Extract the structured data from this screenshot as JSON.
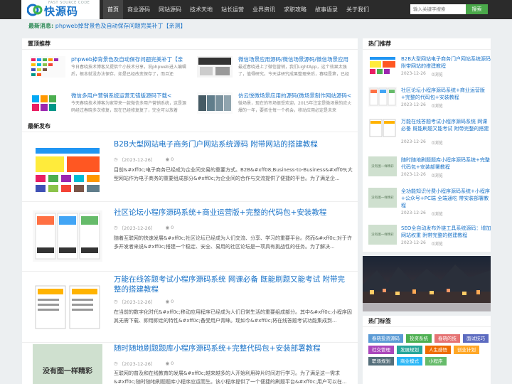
{
  "header": {
    "logo_text": "快源码",
    "logo_sub": "FAST SOURCE CODE",
    "nav": [
      "首页",
      "商业源码",
      "网站源码",
      "技术天地",
      "站长运营",
      "业界资讯",
      "求职攻略",
      "故事语录",
      "关于我们"
    ],
    "search_placeholder": "输入关键字搜索",
    "search_button": "搜索"
  },
  "ticker": {
    "label": "最新消息:",
    "text": "phpweb掉背景色及自动保存问题完美补丁【亲测】"
  },
  "featured": {
    "title": "置顶推荐",
    "items": [
      {
        "title": "phpweb掉背景色及自动保存问题完美补丁【亲",
        "desc": "今日春晓技术博客又提供个小技术分享，说phpweb进入编辑后，根本就没办法保存，如是已经改变保存了，而且还"
      },
      {
        "title": "微信多用户营销系统运营无错版源码下载<",
        "desc": "今天春晓技术博客为家带来一款微信多用户营销系统，这是源码经过春晓多次修复，现在已经修复复了，完全可以放着"
      },
      {
        "title": "微信场景应用源码/微信场景源码/微信场景应用",
        "desc": "最近春晓进上了微信营销，我们LightApp，这个效果太强了，值得研究。今天讲研究成果整理来后，春晓是第，已经"
      },
      {
        "title": "仿云悦微场景应用的源码(微场景制作网站源码<",
        "desc": "微场景，现在的市场很受欢迎，2015年注定是微场景的应火爆的一年，要抓住每一个机会，移动应用必定是未来"
      }
    ]
  },
  "latest": {
    "title": "最新发布",
    "items": [
      {
        "title": "B2B大型网站电子商务门户网站系统源码 附带网站的搭建教程",
        "date": "〔2023-12-26〕",
        "comments": "0",
        "desc": "目前&#xff0c;电子商务已经成为企业间交易的重要方式。B2B&#xff08;Business-to-Business&#xff09;大型网站作为电子商务的重要组成部分&#xff0c;为企业间的合作与交流提供了便捷的平台。为了满足企..."
      },
      {
        "title": "社区论坛小程序源码系统+商业运营版+完整的代码包+安装教程",
        "date": "〔2023-12-26〕",
        "comments": "0",
        "desc": "随着互联网的快速发展&#xff0c;社区论坛已经成为人们交流、分享、学习的重要平台。然而&#xff0c;对于许多开发者来说&#xff0c;搭建一个稳定、安全、易用的社区论坛是一项具有挑战性的任务。为了解决..."
      },
      {
        "title": "万能在线答题考试小程序源码系统 网课必备 既能刷题又能考试 附带完整的搭建教程",
        "date": "〔2023-12-26〕",
        "comments": "0",
        "desc": "在当前的数字化时代&#xff0c;移动应用程序已经成为人们日常生活的重要组成部分。其中&#xff0c;小程序因其无需下载、即用即走的特性&#xff0c;备受用户青睐。现如今&#xff0c;将在线答题考试功能集成到..."
      },
      {
        "title": "随时随地刷题题库小程序源码系统+完整代码包+安装部署教程",
        "date": "〔2023-12-26〕",
        "comments": "0",
        "desc": "互联网的普及和在线教育的发展&#xff0c;越来越多的人开始利用碎片时间进行学习。为了满足这一需求&#xff0c;随时随地刷题题库小程序应运而生。该小程序提供了一个便捷的刷题平台&#xff0c;用户可以在..."
      }
    ],
    "thumb4_text": "没有图一样精彩"
  },
  "sidebar": {
    "rec_title": "热门推荐",
    "items": [
      {
        "title": "B2B大型网站电子商务门户网站系统源码 附带网站的搭建教程",
        "date": "2023-12-26",
        "views": "0浏览"
      },
      {
        "title": "社区论坛小程序源码系统+商业运营版+完整的代码包+安装教程",
        "date": "2023-12-26",
        "views": "0浏览"
      },
      {
        "title": "万能在线答题考试小程序源码系统 网课必备 既能刷题又能考试 附带完整的搭建教程",
        "date": "2023-12-26",
        "views": "0浏览"
      },
      {
        "title": "随时随地刷题题库小程序源码系统+完整代码包+安装部署教程",
        "date": "2023-12-26",
        "views": "0浏览"
      },
      {
        "title": "全功能知识付费小程序源码系统+小程序+公众号+PC端 全端通吃 带安装部署教程",
        "date": "2023-12-26",
        "views": "0浏览"
      },
      {
        "title": "SEO全自动发布外链工具系统源码：增加网站权重 附带完整的搭建教程",
        "date": "2023-12-26",
        "views": "0浏览"
      }
    ],
    "thumb_placeholder": "没有图一样精彩",
    "tags_title": "热门标签",
    "tags": [
      {
        "label": "春晓投资源码",
        "color": "#5b9bd5"
      },
      {
        "label": "投资系统",
        "color": "#4caf50"
      },
      {
        "label": "春晓的技",
        "color": "#e57373"
      },
      {
        "label": "面试技巧",
        "color": "#5c6bc0"
      },
      {
        "label": "社交管理",
        "color": "#ab47bc"
      },
      {
        "label": "发展规划",
        "color": "#26a69a"
      },
      {
        "label": "人生感悟",
        "color": "#ef6c00"
      },
      {
        "label": "创业计划",
        "color": "#ffa726"
      },
      {
        "label": "职场规划",
        "color": "#546e7a"
      },
      {
        "label": "商业模式",
        "color": "#29b6f6"
      },
      {
        "label": "小程序",
        "color": "#66bb6a"
      }
    ]
  }
}
